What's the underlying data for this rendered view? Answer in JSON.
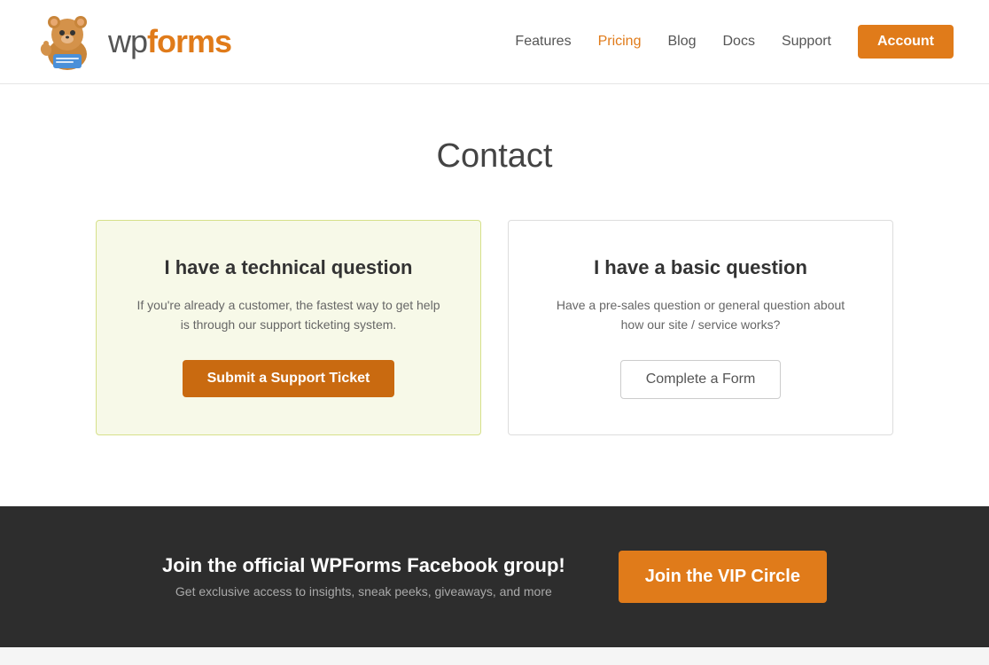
{
  "header": {
    "logo_text_wp": "wp",
    "logo_text_forms": "forms",
    "nav": {
      "features": "Features",
      "pricing": "Pricing",
      "blog": "Blog",
      "docs": "Docs",
      "support": "Support",
      "account": "Account"
    }
  },
  "main": {
    "page_title": "Contact",
    "card_technical": {
      "title": "I have a technical question",
      "description": "If you're already a customer, the fastest way to get help is through our support ticketing system.",
      "button_label": "Submit a Support Ticket"
    },
    "card_basic": {
      "title": "I have a basic question",
      "description": "Have a pre-sales question or general question about how our site / service works?",
      "button_label": "Complete a Form"
    }
  },
  "footer": {
    "heading": "Join the official WPForms Facebook group!",
    "sub": "Get exclusive access to insights, sneak peeks, giveaways, and more",
    "vip_button": "Join the VIP Circle"
  }
}
